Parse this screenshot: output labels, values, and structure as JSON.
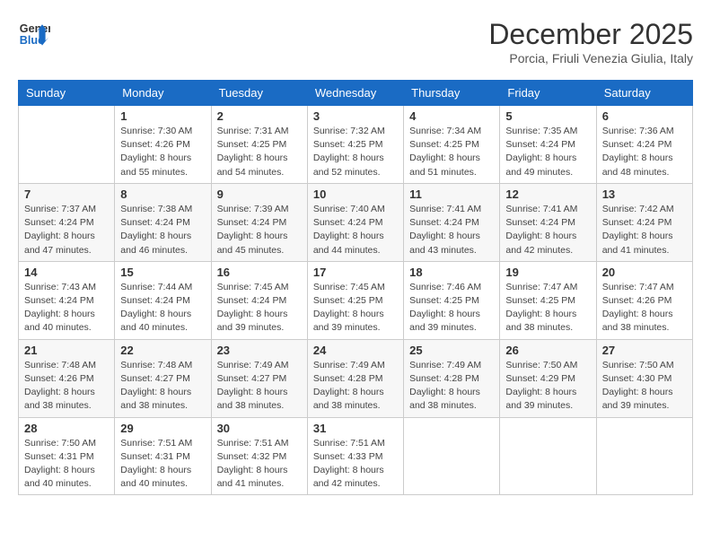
{
  "header": {
    "logo_line1": "General",
    "logo_line2": "Blue",
    "month_title": "December 2025",
    "subtitle": "Porcia, Friuli Venezia Giulia, Italy"
  },
  "days_of_week": [
    "Sunday",
    "Monday",
    "Tuesday",
    "Wednesday",
    "Thursday",
    "Friday",
    "Saturday"
  ],
  "weeks": [
    [
      {
        "day": "",
        "info": ""
      },
      {
        "day": "1",
        "info": "Sunrise: 7:30 AM\nSunset: 4:26 PM\nDaylight: 8 hours\nand 55 minutes."
      },
      {
        "day": "2",
        "info": "Sunrise: 7:31 AM\nSunset: 4:25 PM\nDaylight: 8 hours\nand 54 minutes."
      },
      {
        "day": "3",
        "info": "Sunrise: 7:32 AM\nSunset: 4:25 PM\nDaylight: 8 hours\nand 52 minutes."
      },
      {
        "day": "4",
        "info": "Sunrise: 7:34 AM\nSunset: 4:25 PM\nDaylight: 8 hours\nand 51 minutes."
      },
      {
        "day": "5",
        "info": "Sunrise: 7:35 AM\nSunset: 4:24 PM\nDaylight: 8 hours\nand 49 minutes."
      },
      {
        "day": "6",
        "info": "Sunrise: 7:36 AM\nSunset: 4:24 PM\nDaylight: 8 hours\nand 48 minutes."
      }
    ],
    [
      {
        "day": "7",
        "info": "Sunrise: 7:37 AM\nSunset: 4:24 PM\nDaylight: 8 hours\nand 47 minutes."
      },
      {
        "day": "8",
        "info": "Sunrise: 7:38 AM\nSunset: 4:24 PM\nDaylight: 8 hours\nand 46 minutes."
      },
      {
        "day": "9",
        "info": "Sunrise: 7:39 AM\nSunset: 4:24 PM\nDaylight: 8 hours\nand 45 minutes."
      },
      {
        "day": "10",
        "info": "Sunrise: 7:40 AM\nSunset: 4:24 PM\nDaylight: 8 hours\nand 44 minutes."
      },
      {
        "day": "11",
        "info": "Sunrise: 7:41 AM\nSunset: 4:24 PM\nDaylight: 8 hours\nand 43 minutes."
      },
      {
        "day": "12",
        "info": "Sunrise: 7:41 AM\nSunset: 4:24 PM\nDaylight: 8 hours\nand 42 minutes."
      },
      {
        "day": "13",
        "info": "Sunrise: 7:42 AM\nSunset: 4:24 PM\nDaylight: 8 hours\nand 41 minutes."
      }
    ],
    [
      {
        "day": "14",
        "info": "Sunrise: 7:43 AM\nSunset: 4:24 PM\nDaylight: 8 hours\nand 40 minutes."
      },
      {
        "day": "15",
        "info": "Sunrise: 7:44 AM\nSunset: 4:24 PM\nDaylight: 8 hours\nand 40 minutes."
      },
      {
        "day": "16",
        "info": "Sunrise: 7:45 AM\nSunset: 4:24 PM\nDaylight: 8 hours\nand 39 minutes."
      },
      {
        "day": "17",
        "info": "Sunrise: 7:45 AM\nSunset: 4:25 PM\nDaylight: 8 hours\nand 39 minutes."
      },
      {
        "day": "18",
        "info": "Sunrise: 7:46 AM\nSunset: 4:25 PM\nDaylight: 8 hours\nand 39 minutes."
      },
      {
        "day": "19",
        "info": "Sunrise: 7:47 AM\nSunset: 4:25 PM\nDaylight: 8 hours\nand 38 minutes."
      },
      {
        "day": "20",
        "info": "Sunrise: 7:47 AM\nSunset: 4:26 PM\nDaylight: 8 hours\nand 38 minutes."
      }
    ],
    [
      {
        "day": "21",
        "info": "Sunrise: 7:48 AM\nSunset: 4:26 PM\nDaylight: 8 hours\nand 38 minutes."
      },
      {
        "day": "22",
        "info": "Sunrise: 7:48 AM\nSunset: 4:27 PM\nDaylight: 8 hours\nand 38 minutes."
      },
      {
        "day": "23",
        "info": "Sunrise: 7:49 AM\nSunset: 4:27 PM\nDaylight: 8 hours\nand 38 minutes."
      },
      {
        "day": "24",
        "info": "Sunrise: 7:49 AM\nSunset: 4:28 PM\nDaylight: 8 hours\nand 38 minutes."
      },
      {
        "day": "25",
        "info": "Sunrise: 7:49 AM\nSunset: 4:28 PM\nDaylight: 8 hours\nand 38 minutes."
      },
      {
        "day": "26",
        "info": "Sunrise: 7:50 AM\nSunset: 4:29 PM\nDaylight: 8 hours\nand 39 minutes."
      },
      {
        "day": "27",
        "info": "Sunrise: 7:50 AM\nSunset: 4:30 PM\nDaylight: 8 hours\nand 39 minutes."
      }
    ],
    [
      {
        "day": "28",
        "info": "Sunrise: 7:50 AM\nSunset: 4:31 PM\nDaylight: 8 hours\nand 40 minutes."
      },
      {
        "day": "29",
        "info": "Sunrise: 7:51 AM\nSunset: 4:31 PM\nDaylight: 8 hours\nand 40 minutes."
      },
      {
        "day": "30",
        "info": "Sunrise: 7:51 AM\nSunset: 4:32 PM\nDaylight: 8 hours\nand 41 minutes."
      },
      {
        "day": "31",
        "info": "Sunrise: 7:51 AM\nSunset: 4:33 PM\nDaylight: 8 hours\nand 42 minutes."
      },
      {
        "day": "",
        "info": ""
      },
      {
        "day": "",
        "info": ""
      },
      {
        "day": "",
        "info": ""
      }
    ]
  ]
}
